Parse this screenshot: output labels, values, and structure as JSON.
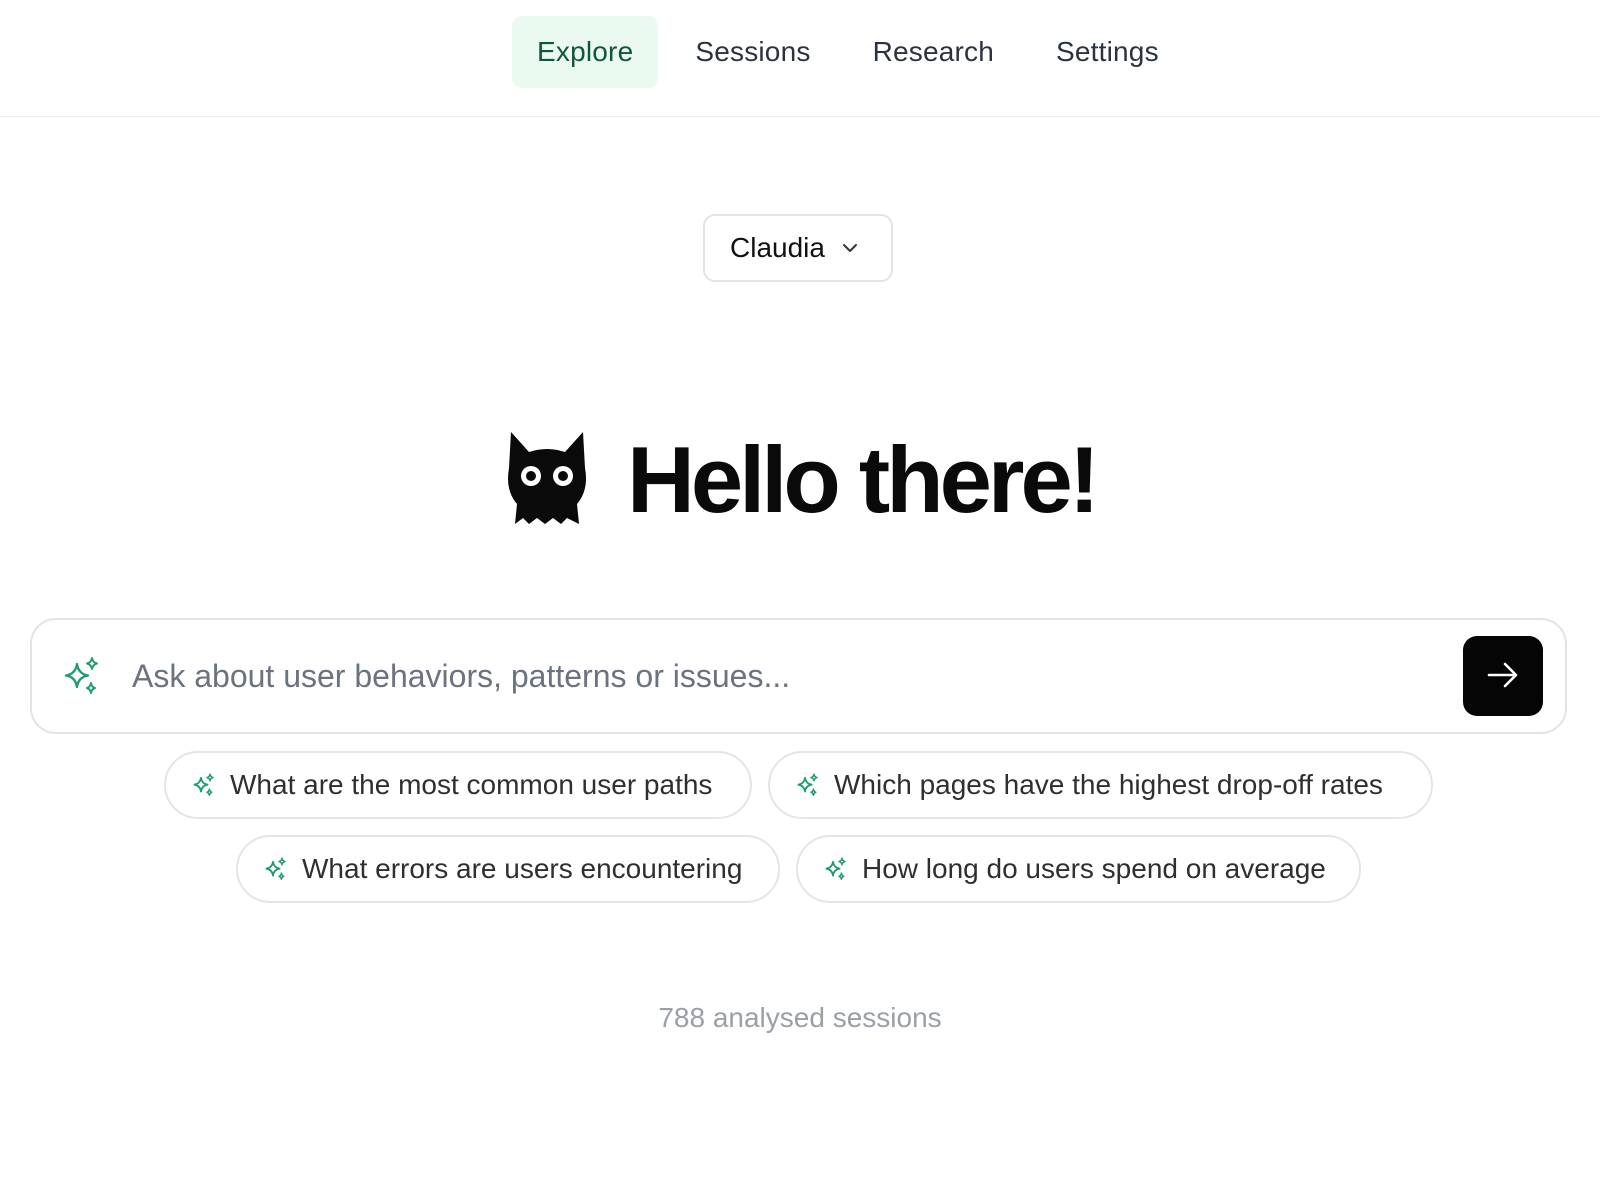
{
  "nav": {
    "tabs": [
      {
        "label": "Explore",
        "active": true
      },
      {
        "label": "Sessions",
        "active": false
      },
      {
        "label": "Research",
        "active": false
      },
      {
        "label": "Settings",
        "active": false
      }
    ]
  },
  "user_selector": {
    "value": "Claudia",
    "icon": "chevron-down-icon"
  },
  "hero": {
    "greeting": "Hello there!",
    "icon": "cat-mascot-icon"
  },
  "search": {
    "placeholder": "Ask about user behaviors, patterns or issues...",
    "value": "",
    "icon": "sparkles-icon",
    "submit_icon": "arrow-right-icon"
  },
  "suggestions": [
    {
      "label": "What are the most common user paths"
    },
    {
      "label": "Which pages have the highest drop-off rates"
    },
    {
      "label": "What errors are users encountering"
    },
    {
      "label": "How long do users spend on average"
    }
  ],
  "footer": {
    "sessions_text": "788 analysed sessions"
  },
  "colors": {
    "accent_green": "#1f9d6b",
    "active_tab_bg": "#eafaf1",
    "active_tab_text": "#11573a"
  }
}
